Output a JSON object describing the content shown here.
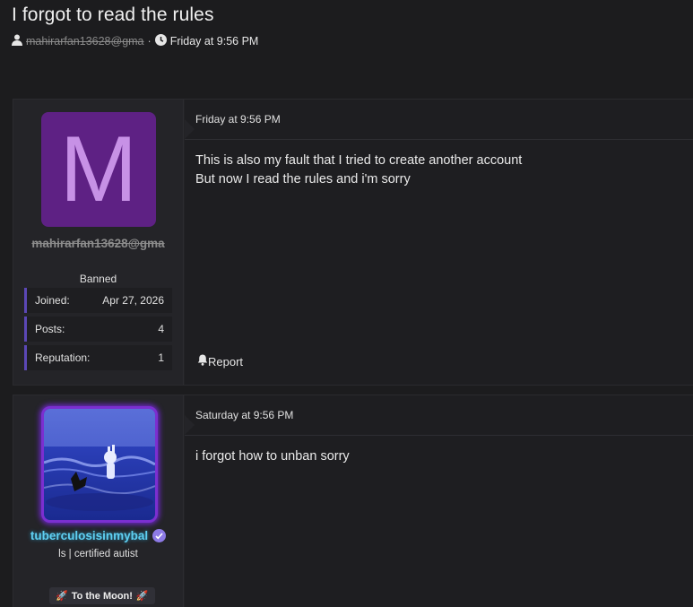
{
  "thread": {
    "title": "I forgot to read the rules",
    "author": "mahirarfan13628@gma",
    "separator": "·",
    "date": "Friday at 9:56 PM"
  },
  "posts": [
    {
      "date": "Friday at 9:56 PM",
      "body_lines": [
        "This is also my fault that I tried to create another account",
        "But now I read the rules and i'm sorry"
      ],
      "report_label": "Report",
      "user": {
        "avatar_letter": "M",
        "avatar_color": "#5e2184",
        "username": "mahirarfan13628@gma",
        "title": "Banned",
        "stats": [
          {
            "label": "Joined:",
            "value": "Apr 27, 2026"
          },
          {
            "label": "Posts:",
            "value": "4"
          },
          {
            "label": "Reputation:",
            "value": "1"
          }
        ]
      }
    },
    {
      "date": "Saturday at 9:56 PM",
      "body_lines": [
        "i forgot how to unban sorry"
      ],
      "user": {
        "username": "tuberculosisinmybal",
        "username_color": "#5fd0f2",
        "title": "ls | certified autist",
        "badge": "To the Moon!"
      }
    }
  ],
  "icons": {
    "user": "user-icon",
    "clock": "clock-icon",
    "bell": "bell-icon",
    "verified": "verified-badge-icon",
    "rocket": "rocket-icon"
  },
  "colors": {
    "background": "#1c1c1e",
    "stat_accent": "#5b47b5",
    "avatar_glow": "#7b2fd0"
  }
}
